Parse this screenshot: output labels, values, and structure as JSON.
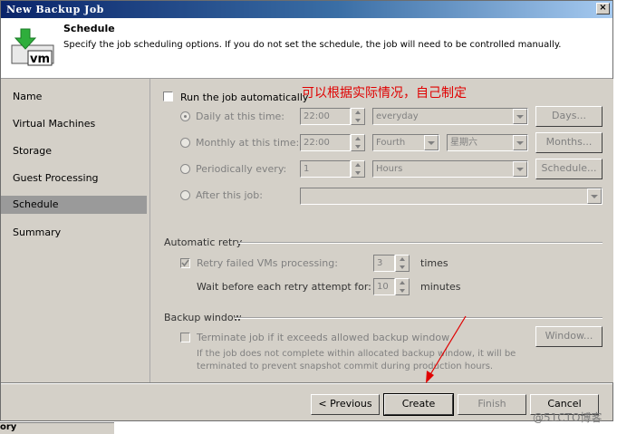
{
  "window": {
    "title": "New Backup Job",
    "close_glyph": "×"
  },
  "header": {
    "title": "Schedule",
    "description": "Specify the job scheduling options. If you do not set the schedule, the job will need to be controlled manually.",
    "icon": "vm-download-icon",
    "icon_text": "vm"
  },
  "nav": {
    "items": [
      {
        "label": "Name"
      },
      {
        "label": "Virtual Machines"
      },
      {
        "label": "Storage"
      },
      {
        "label": "Guest Processing"
      },
      {
        "label": "Schedule"
      },
      {
        "label": "Summary"
      }
    ]
  },
  "schedule": {
    "run_auto_label": "Run the job automatically",
    "daily": {
      "label": "Daily at this time:",
      "time": "22:00",
      "option": "everyday",
      "button": "Days..."
    },
    "monthly": {
      "label": "Monthly at this time:",
      "time": "22:00",
      "week": "Fourth",
      "day": "星期六",
      "button": "Months..."
    },
    "periodically": {
      "label": "Periodically every:",
      "value": "1",
      "unit": "Hours",
      "button": "Schedule..."
    },
    "after": {
      "label": "After this job:",
      "value": ""
    }
  },
  "retry": {
    "group_label": "Automatic retry",
    "retry_label": "Retry failed VMs processing:",
    "retry_value": "3",
    "retry_unit": "times",
    "wait_label": "Wait before each retry attempt for:",
    "wait_value": "10",
    "wait_unit": "minutes"
  },
  "backup_window": {
    "group_label": "Backup window",
    "terminate_label": "Terminate job if it exceeds allowed backup window",
    "window_button": "Window...",
    "note_line1": "If the job does not complete within allocated backup window, it will be",
    "note_line2": "terminated to prevent snapshot commit during production hours."
  },
  "footer": {
    "previous": "< Previous",
    "create": "Create",
    "finish": "Finish",
    "cancel": "Cancel"
  },
  "annotation": "可以根据实际情况，自己制定",
  "watermark": "@51CTO博客",
  "bottom_text": "ory",
  "colors": {
    "annotation": "#e00000",
    "titlebar_start": "#0a246a",
    "selected_nav": "#9a9a9a"
  }
}
